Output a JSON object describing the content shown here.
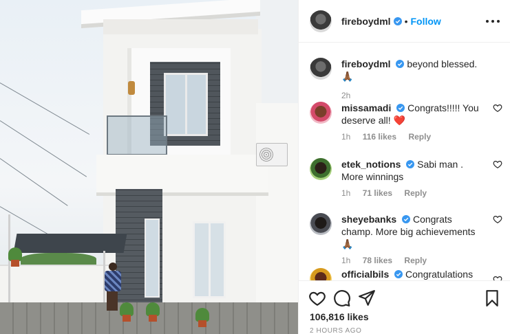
{
  "post": {
    "owner": "fireboydml",
    "follow_label": "Follow",
    "separator": "•",
    "caption": {
      "username": "fireboydml",
      "text": "beyond blessed. 🙏🏾",
      "age": "2h"
    },
    "likes": "106,816 likes",
    "posted_ago": "2 HOURS AGO"
  },
  "comments": [
    {
      "username": "missamadi",
      "text": "Congrats!!!!! You deserve all! ❤️",
      "age": "1h",
      "likes": "116 likes",
      "reply_label": "Reply"
    },
    {
      "username": "etek_notions",
      "text": "Sabi man . More winnings",
      "age": "1h",
      "likes": "71 likes",
      "reply_label": "Reply"
    },
    {
      "username": "sheyebanks",
      "text": "Congrats champ. More big achievements 🙏🏾",
      "age": "1h",
      "likes": "78 likes",
      "reply_label": "Reply"
    },
    {
      "username": "officialbils",
      "text": "Congratulations",
      "age": "",
      "likes": "",
      "reply_label": ""
    }
  ],
  "icons": {
    "verified": "verified-badge-icon",
    "more": "more-options-icon",
    "like": "heart-icon",
    "comment": "comment-icon",
    "share": "share-icon",
    "save": "bookmark-icon"
  },
  "colors": {
    "accent": "#0095f6",
    "text": "#262626",
    "muted": "#8e8e8e",
    "divider": "#efefef",
    "heart_red": "#ed4956"
  }
}
